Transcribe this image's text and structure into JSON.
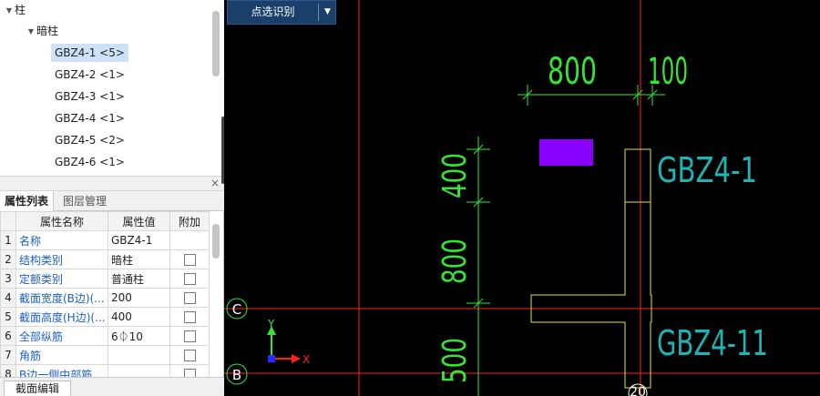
{
  "tree": {
    "root_label": "柱",
    "group_label": "暗柱",
    "items": [
      {
        "label": "GBZ4-1 <5>",
        "selected": true
      },
      {
        "label": "GBZ4-2 <1>",
        "selected": false
      },
      {
        "label": "GBZ4-3 <1>",
        "selected": false
      },
      {
        "label": "GBZ4-4 <1>",
        "selected": false
      },
      {
        "label": "GBZ4-5 <2>",
        "selected": false
      },
      {
        "label": "GBZ4-6 <1>",
        "selected": false
      }
    ]
  },
  "panel_tabs": {
    "properties": "属性列表",
    "layers": "图层管理"
  },
  "close_glyph": "×",
  "prop_table": {
    "headers": [
      "属性名称",
      "属性值",
      "附加"
    ],
    "rows": [
      {
        "idx": "1",
        "name": "名称",
        "value": "GBZ4-1",
        "has_check": false
      },
      {
        "idx": "2",
        "name": "结构类别",
        "value": "暗柱",
        "has_check": true
      },
      {
        "idx": "3",
        "name": "定额类别",
        "value": "普通柱",
        "has_check": true
      },
      {
        "idx": "4",
        "name": "截面宽度(B边)(...",
        "value": "200",
        "has_check": true
      },
      {
        "idx": "5",
        "name": "截面高度(H边)(...",
        "value": "400",
        "has_check": true
      },
      {
        "idx": "6",
        "name": "全部纵筋",
        "value": "6⏀10",
        "has_check": true
      },
      {
        "idx": "7",
        "name": "角筋",
        "value": "",
        "has_check": true
      },
      {
        "idx": "8",
        "name": "B边一侧中部筋",
        "value": "",
        "has_check": true
      }
    ]
  },
  "bottom_tab": "截面编辑",
  "toolbar": {
    "select_label": "点选识别",
    "dropdown_icon": "caret-down-icon"
  },
  "cad": {
    "dims": {
      "top_a": "800",
      "top_b": "100",
      "left_a": "400",
      "left_b": "800",
      "left_c": "500",
      "bottom": "20"
    },
    "labels": {
      "col_1": "GBZ4-1",
      "col_2": "GBZ4-11"
    },
    "axes": {
      "c": "C",
      "b": "B",
      "ucs_x": "X",
      "ucs_y": "Y"
    },
    "colors": {
      "background": "#000000",
      "grid": "#ff2020",
      "dimension": "#36e336",
      "outline": "#e3e336",
      "label": "#1fb3b3",
      "highlight": "#8a00ff"
    }
  }
}
